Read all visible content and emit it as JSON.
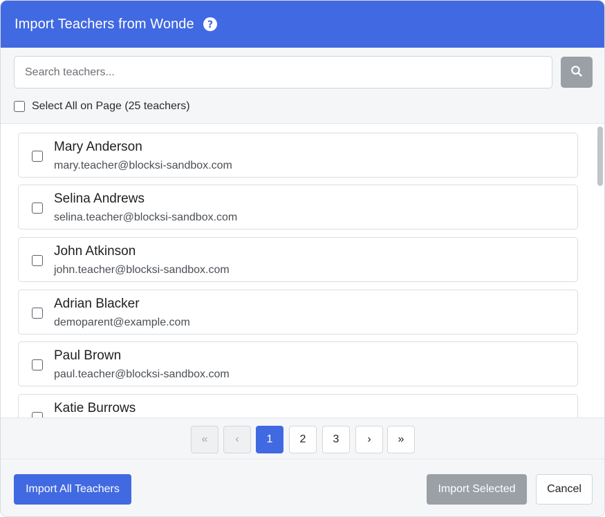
{
  "modal": {
    "title": "Import Teachers from Wonde"
  },
  "search": {
    "placeholder": "Search teachers...",
    "value": ""
  },
  "select_all": {
    "label": "Select All on Page (25 teachers)",
    "checked": false
  },
  "teachers": [
    {
      "name": "Mary Anderson",
      "email": "mary.teacher@blocksi-sandbox.com",
      "checked": false
    },
    {
      "name": "Selina Andrews",
      "email": "selina.teacher@blocksi-sandbox.com",
      "checked": false
    },
    {
      "name": "John Atkinson",
      "email": "john.teacher@blocksi-sandbox.com",
      "checked": false
    },
    {
      "name": "Adrian Blacker",
      "email": "demoparent@example.com",
      "checked": false
    },
    {
      "name": "Paul Brown",
      "email": "paul.teacher@blocksi-sandbox.com",
      "checked": false
    },
    {
      "name": "Katie Burrows",
      "email": "",
      "checked": false
    }
  ],
  "pagination": {
    "first_label": "«",
    "prev_label": "‹",
    "pages": [
      "1",
      "2",
      "3"
    ],
    "current_page": "1",
    "next_label": "›",
    "last_label": "»"
  },
  "footer": {
    "import_all_label": "Import All Teachers",
    "import_selected_label": "Import Selected",
    "cancel_label": "Cancel"
  },
  "colors": {
    "primary": "#4169e1",
    "disabled": "#9aa0a6"
  },
  "icons": {
    "help": "question-circle-icon",
    "search": "magnifier-icon"
  }
}
